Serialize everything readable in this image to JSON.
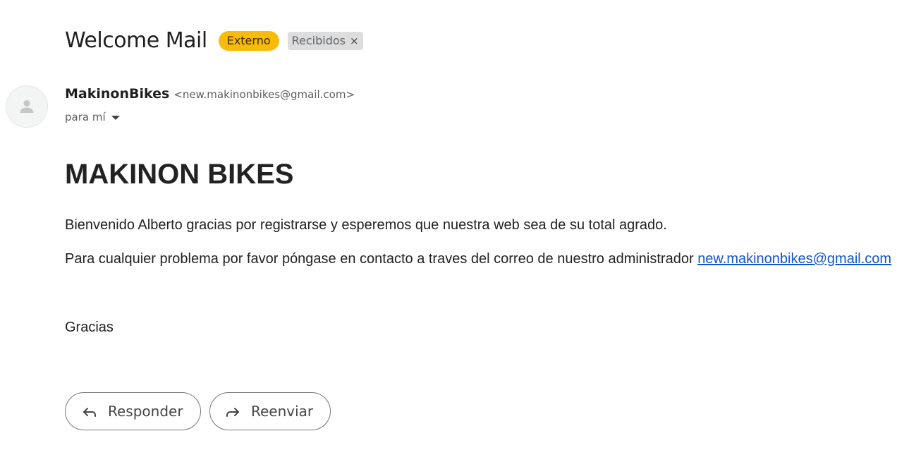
{
  "email": {
    "subject": "Welcome Mail",
    "labels": {
      "external": "Externo",
      "inbox": "Recibidos",
      "remove_glyph": "×"
    },
    "sender": {
      "name": "MakinonBikes",
      "email": "<new.makinonbikes@gmail.com>",
      "avatar_icon": "person-icon"
    },
    "recipient": {
      "label": "para mí"
    },
    "body": {
      "heading": "MAKINON BIKES",
      "paragraph1": "Bienvenido Alberto gracias por registrarse y esperemos que nuestra web sea de su total agrado.",
      "paragraph2_text": "Para cualquier problema por favor póngase en contacto a traves del correo de nuestro administrador ",
      "paragraph2_link": "new.makinonbikes@gmail.com",
      "closing": "Gracias"
    },
    "actions": {
      "reply_label": "Responder",
      "reply_icon": "reply-icon",
      "forward_label": "Reenviar",
      "forward_icon": "forward-icon"
    }
  },
  "colors": {
    "external_chip": "#f9bb09",
    "inbox_chip": "#dddddd",
    "link": "#1155cc",
    "text": "#222222"
  }
}
